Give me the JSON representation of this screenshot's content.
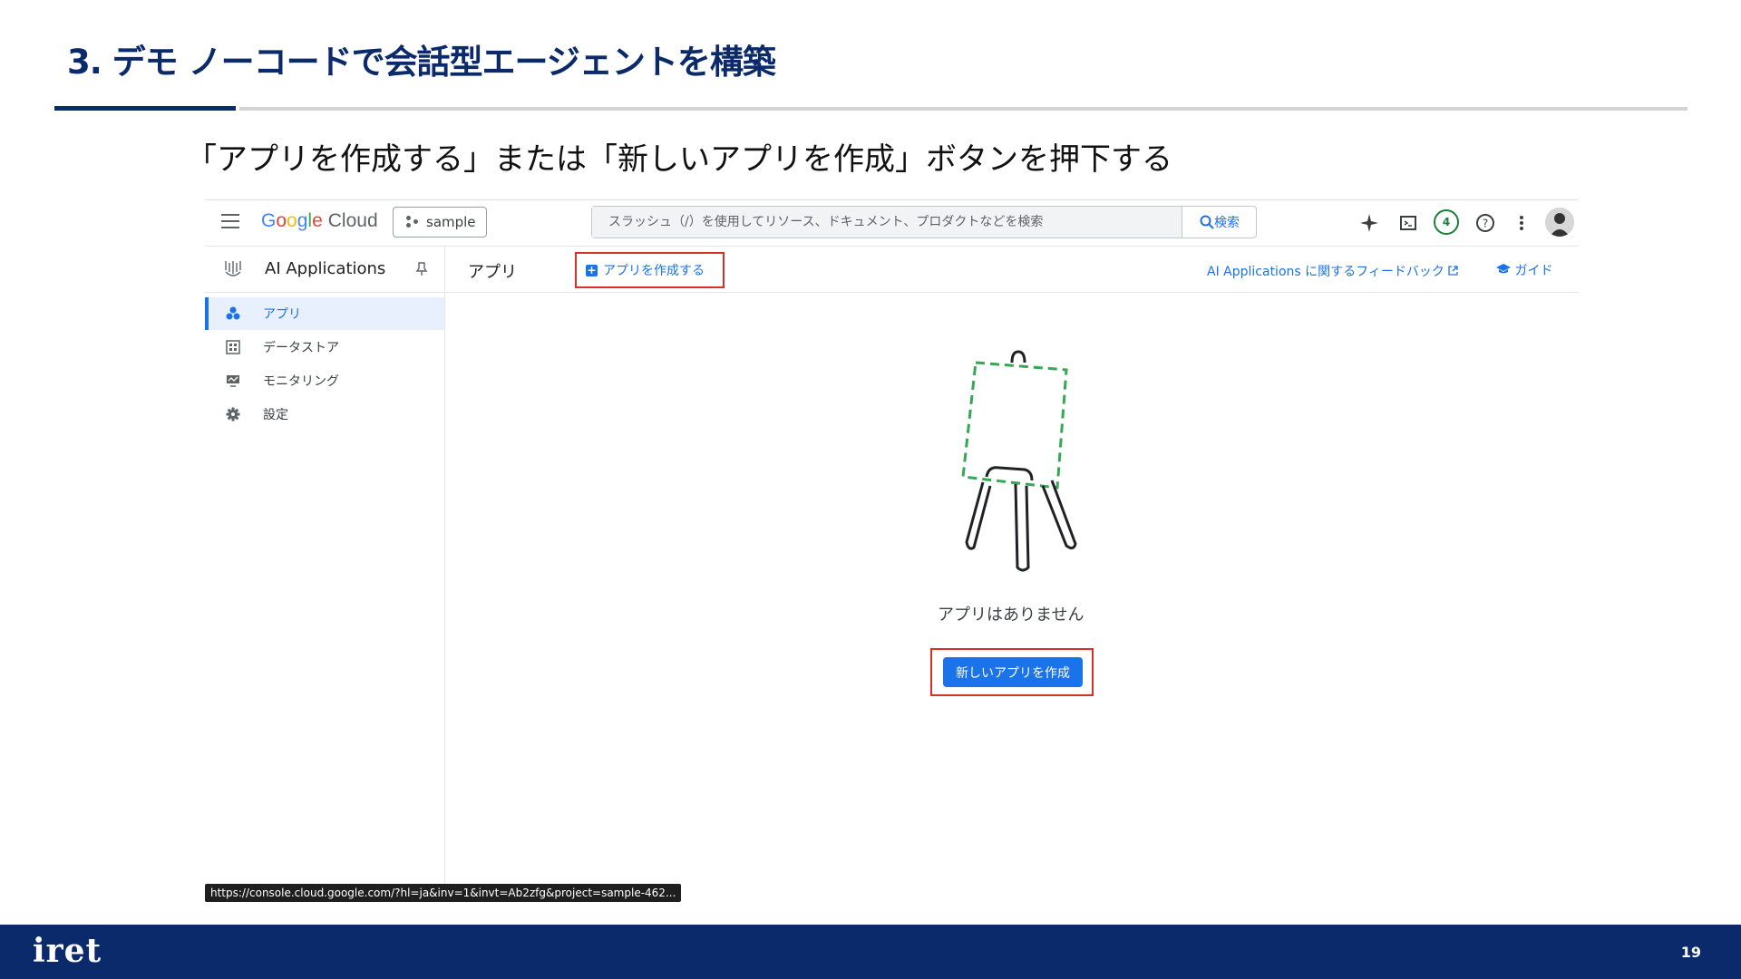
{
  "slide": {
    "title": "3. デモ ノーコードで会話型エージェントを構築",
    "subtitle": "「アプリを作成する」または「新しいアプリを作成」ボタンを押下する",
    "page_number": "19",
    "footer_logo": "iret"
  },
  "colors": {
    "brand": "#0b2a6b",
    "accent": "#1a73e8",
    "highlight": "#d93025"
  },
  "topbar": {
    "logo_google": [
      "G",
      "o",
      "o",
      "g",
      "l",
      "e"
    ],
    "logo_cloud": "Cloud",
    "project": "sample",
    "search_placeholder": "スラッシュ（/）を使用してリソース、ドキュメント、プロダクトなどを検索",
    "search_button": "検索",
    "notifications": "4",
    "icons": [
      "menu-icon",
      "sparkle-icon",
      "terminal-icon",
      "help-icon",
      "more-vert-icon",
      "avatar"
    ]
  },
  "subbar": {
    "product": "AI Applications",
    "page": "アプリ",
    "create_link": "アプリを作成する",
    "feedback": "AI Applications に関するフィードバック",
    "guide": "ガイド"
  },
  "sidebar": {
    "items": [
      {
        "label": "アプリ",
        "icon": "apps-icon",
        "active": true
      },
      {
        "label": "データストア",
        "icon": "datastore-icon",
        "active": false
      },
      {
        "label": "モニタリング",
        "icon": "monitoring-icon",
        "active": false
      },
      {
        "label": "設定",
        "icon": "settings-icon",
        "active": false
      }
    ]
  },
  "main": {
    "empty_text": "アプリはありません",
    "new_app_button": "新しいアプリを作成"
  },
  "status_url": "https://console.cloud.google.com/?hl=ja&inv=1&invt=Ab2zfg&project=sample-462..."
}
